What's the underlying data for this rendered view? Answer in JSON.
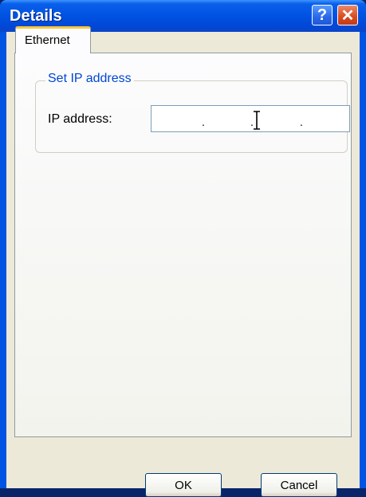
{
  "window": {
    "title": "Details",
    "help_label": "?",
    "close_label": "✕"
  },
  "tabs": [
    {
      "label": "Ethernet",
      "selected": true
    }
  ],
  "group": {
    "title": "Set IP address",
    "ip_label": "IP address:",
    "ip_value": [
      "",
      "",
      "",
      ""
    ],
    "separator": "."
  },
  "buttons": {
    "ok": "OK",
    "cancel": "Cancel"
  },
  "colors": {
    "titlebar": "#0054e3",
    "client": "#ece9d8",
    "group_title": "#0046d5",
    "tab_highlight": "#ffc83c"
  }
}
